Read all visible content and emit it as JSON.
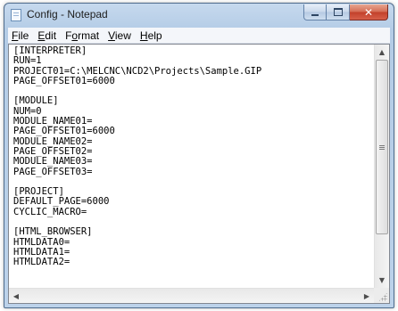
{
  "window": {
    "title": "Config - Notepad"
  },
  "controls": {
    "minimize_icon": "minimize-icon",
    "maximize_icon": "maximize-icon",
    "close_icon": "close-icon",
    "close_glyph": "✕"
  },
  "menu": {
    "items": [
      {
        "accel": "F",
        "rest": "ile"
      },
      {
        "accel": "E",
        "rest": "dit"
      },
      {
        "accel": "",
        "pre": "F",
        "accel2": "o",
        "rest": "rmat"
      },
      {
        "accel": "V",
        "rest": "iew"
      },
      {
        "accel": "H",
        "rest": "elp"
      }
    ]
  },
  "editor": {
    "lines": [
      "[INTERPRETER]",
      "RUN=1",
      "PROJECT01=C:\\MELCNC\\NCD2\\Projects\\Sample.GIP",
      "PAGE_OFFSET01=6000",
      "",
      "[MODULE]",
      "NUM=0",
      "MODULE_NAME01=",
      "PAGE_OFFSET01=6000",
      "MODULE_NAME02=",
      "PAGE_OFFSET02=",
      "MODULE_NAME03=",
      "PAGE_OFFSET03=",
      "",
      "[PROJECT]",
      "DEFAULT_PAGE=6000",
      "CYCLIC_MACRO=",
      "",
      "[HTML_BROWSER]",
      "HTMLDATA0=",
      "HTMLDATA1=",
      "HTMLDATA2="
    ]
  },
  "scrollbars": {
    "up_arrow": "▲",
    "down_arrow": "▼",
    "left_arrow": "◀",
    "right_arrow": "▶"
  },
  "colors": {
    "close_button": "#c2402a",
    "title_bar": "#c6d9ee"
  }
}
